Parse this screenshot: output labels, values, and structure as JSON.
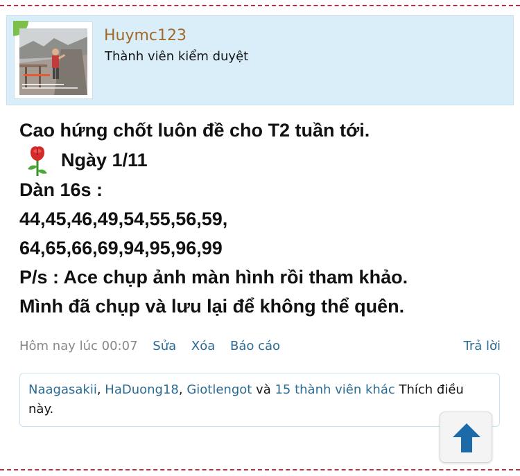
{
  "author": {
    "username": "Huymc123",
    "role": "Thành viên kiểm duyệt"
  },
  "post": {
    "line1": "Cao hứng chốt luôn đề cho T2 tuần tới.",
    "date_line": "Ngày 1/11",
    "line3": "Dàn 16s :",
    "line4": "44,45,46,49,54,55,56,59,",
    "line5": "64,65,66,69,94,95,96,99",
    "line6": "P/s : Ace chụp ảnh màn hình rồi tham khảo.",
    "line7": "Mình đã chụp và lưu lại để không thể quên."
  },
  "meta": {
    "timestamp": "Hôm nay lúc 00:07",
    "edit_label": "Sửa",
    "delete_label": "Xóa",
    "report_label": "Báo cáo",
    "reply_label": "Trả lời"
  },
  "likes": {
    "users": [
      "Naagasakii",
      "HaDuong18",
      "Giotlengot"
    ],
    "separator": ", ",
    "conjunction": " và ",
    "others_label": "15 thành viên khác",
    "suffix": " Thích điều này."
  },
  "icons": {
    "rose": "rose-icon",
    "scroll_top": "arrow-up-icon"
  },
  "colors": {
    "link": "#2b6b93",
    "username": "#a06a28",
    "card_bg": "#daeefa",
    "divider": "#c7293f",
    "arrow": "#1d6aa8"
  }
}
